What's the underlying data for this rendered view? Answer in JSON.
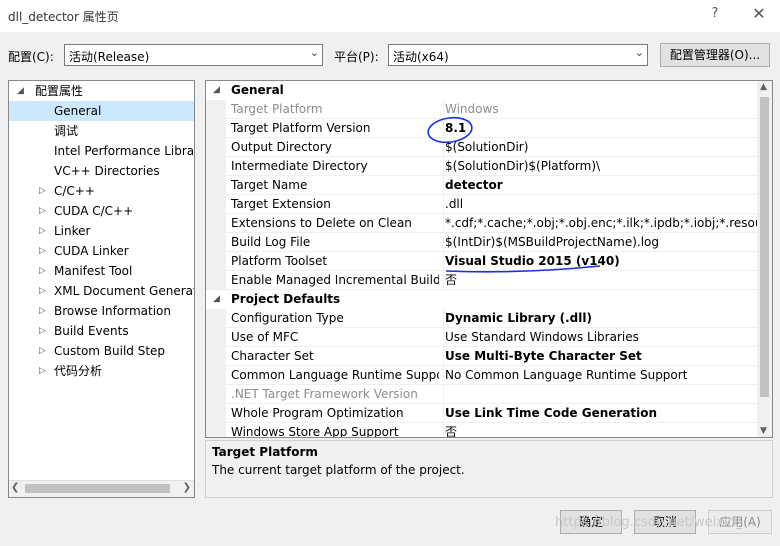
{
  "window": {
    "title": "dll_detector 属性页",
    "help_glyph": "?",
    "close_glyph": "✕"
  },
  "toolbar": {
    "config_label": "配置(C):",
    "config_value": "活动(Release)",
    "platform_label": "平台(P):",
    "platform_value": "活动(x64)",
    "manager_button": "配置管理器(O)..."
  },
  "tree": {
    "root": "配置属性",
    "items": [
      {
        "label": "General",
        "selected": true,
        "expandable": false
      },
      {
        "label": "调试",
        "selected": false,
        "expandable": false
      },
      {
        "label": "Intel Performance Librar",
        "selected": false,
        "expandable": false
      },
      {
        "label": "VC++ Directories",
        "selected": false,
        "expandable": false
      },
      {
        "label": "C/C++",
        "selected": false,
        "expandable": true
      },
      {
        "label": "CUDA C/C++",
        "selected": false,
        "expandable": true
      },
      {
        "label": "Linker",
        "selected": false,
        "expandable": true
      },
      {
        "label": "CUDA Linker",
        "selected": false,
        "expandable": true
      },
      {
        "label": "Manifest Tool",
        "selected": false,
        "expandable": true
      },
      {
        "label": "XML Document Generat",
        "selected": false,
        "expandable": true
      },
      {
        "label": "Browse Information",
        "selected": false,
        "expandable": true
      },
      {
        "label": "Build Events",
        "selected": false,
        "expandable": true
      },
      {
        "label": "Custom Build Step",
        "selected": false,
        "expandable": true
      },
      {
        "label": "代码分析",
        "selected": false,
        "expandable": true
      }
    ]
  },
  "grid": {
    "sections": [
      {
        "title": "General",
        "rows": [
          {
            "name": "Target Platform",
            "value": "Windows",
            "gray": true,
            "bold": false
          },
          {
            "name": "Target Platform Version",
            "value": "8.1",
            "gray": false,
            "bold": true
          },
          {
            "name": "Output Directory",
            "value": "$(SolutionDir)",
            "gray": false,
            "bold": false
          },
          {
            "name": "Intermediate Directory",
            "value": "$(SolutionDir)$(Platform)\\",
            "gray": false,
            "bold": false
          },
          {
            "name": "Target Name",
            "value": "detector",
            "gray": false,
            "bold": true
          },
          {
            "name": "Target Extension",
            "value": ".dll",
            "gray": false,
            "bold": false
          },
          {
            "name": "Extensions to Delete on Clean",
            "value": "*.cdf;*.cache;*.obj;*.obj.enc;*.ilk;*.ipdb;*.iobj;*.resource",
            "gray": false,
            "bold": false
          },
          {
            "name": "Build Log File",
            "value": "$(IntDir)$(MSBuildProjectName).log",
            "gray": false,
            "bold": false
          },
          {
            "name": "Platform Toolset",
            "value": "Visual Studio 2015 (v140)",
            "gray": false,
            "bold": true
          },
          {
            "name": "Enable Managed Incremental Build",
            "value": "否",
            "gray": false,
            "bold": false
          }
        ]
      },
      {
        "title": "Project Defaults",
        "rows": [
          {
            "name": "Configuration Type",
            "value": "Dynamic Library (.dll)",
            "gray": false,
            "bold": true
          },
          {
            "name": "Use of MFC",
            "value": "Use Standard Windows Libraries",
            "gray": false,
            "bold": false
          },
          {
            "name": "Character Set",
            "value": "Use Multi-Byte Character Set",
            "gray": false,
            "bold": true
          },
          {
            "name": "Common Language Runtime Suppor",
            "value": "No Common Language Runtime Support",
            "gray": false,
            "bold": false
          },
          {
            "name": ".NET Target Framework Version",
            "value": "",
            "gray": true,
            "bold": false
          },
          {
            "name": "Whole Program Optimization",
            "value": "Use Link Time Code Generation",
            "gray": false,
            "bold": true
          },
          {
            "name": "Windows Store App Support",
            "value": "否",
            "gray": false,
            "bold": false
          }
        ]
      }
    ]
  },
  "description": {
    "title": "Target Platform",
    "text": "The current target platform of the project."
  },
  "buttons": {
    "ok": "确定",
    "cancel": "取消",
    "apply": "应用(A)"
  },
  "watermark": "https://blog.csdn.net/weixin_..."
}
